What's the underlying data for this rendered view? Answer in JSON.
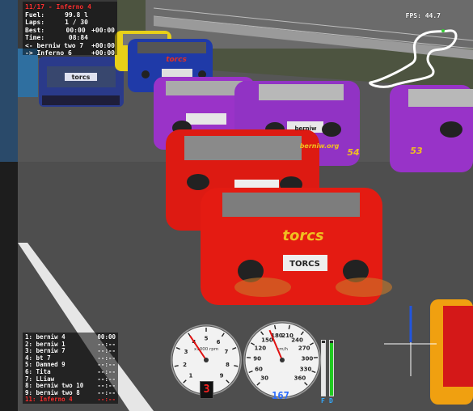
{
  "hud": {
    "position_title": "11/17 - Inferno 4",
    "fuel_label": "Fuel:",
    "fuel_value": "99.8 l",
    "laps_label": "Laps:",
    "laps_value": "1 / 30",
    "best_label": "Best:",
    "best_value": "00:00",
    "best_gap": "+00:00",
    "time_label": "Time:",
    "time_value": "08:84",
    "ahead_label": "<- berniw two 7",
    "ahead_gap": "+00:00",
    "behind_label": "-> Inferno 6",
    "behind_gap": "+00:00",
    "fps": "FPS: 44.7"
  },
  "leaderboard": [
    {
      "name": "1: berniw 4",
      "time": "00:00"
    },
    {
      "name": "2: berniw 1",
      "time": "--:--"
    },
    {
      "name": "3: berniw 7",
      "time": "--:--"
    },
    {
      "name": "4: bt 7",
      "time": "--:--"
    },
    {
      "name": "5: Damned 9",
      "time": "--:--"
    },
    {
      "name": "6: Tita",
      "time": "--:--"
    },
    {
      "name": "7: LLiaw",
      "time": "--:--"
    },
    {
      "name": "8: berniw two 10",
      "time": "--:--"
    },
    {
      "name": "9: berniw two 8",
      "time": "--:--"
    },
    {
      "name": "11: Inferno 4",
      "time": "--:--"
    }
  ],
  "tachometer": {
    "unit": "x1000 rpm",
    "ticks": [
      "1",
      "2",
      "3",
      "4",
      "5",
      "6",
      "7",
      "8",
      "9"
    ],
    "gear": "3",
    "needle_value": 4.0
  },
  "speedometer": {
    "unit": "km/h",
    "ticks": [
      "30",
      "60",
      "90",
      "120",
      "150",
      "180",
      "210",
      "240",
      "270",
      "300",
      "330",
      "360"
    ],
    "speed": "167",
    "needle_value": 167
  },
  "bars": {
    "fuel_letter": "F",
    "damage_letter": "D",
    "fuel_level": 0.95,
    "damage_level": 0.95
  },
  "car_texts": {
    "red_car_brand": "torcs",
    "red_car_plate": "TORCS",
    "purple_car_plate": "berniw",
    "purple_car_site": "berniw.org",
    "purple_car_number": "54",
    "right_car_number": "53",
    "blue_car_brand": "torcs",
    "left_car_plate": "torcs"
  },
  "colors": {
    "accent_red": "#ff3333",
    "speed_blue": "#2a6cff"
  }
}
